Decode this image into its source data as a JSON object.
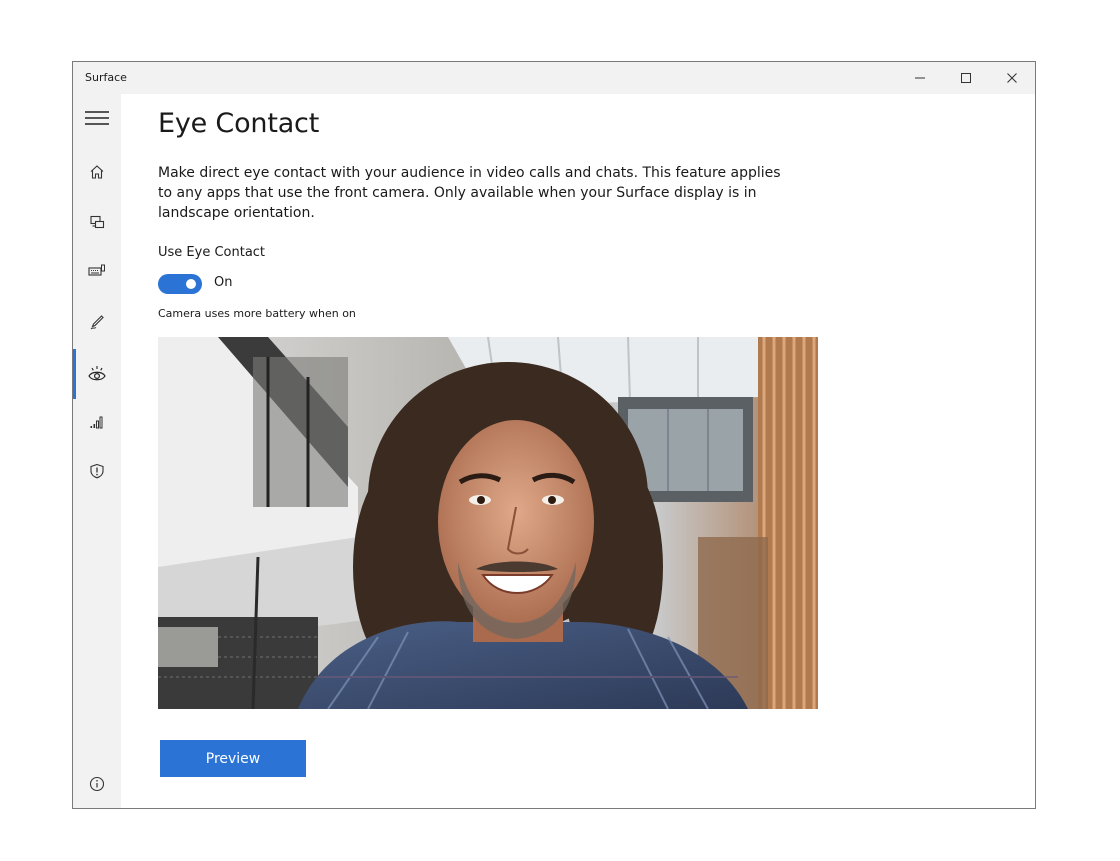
{
  "window": {
    "title": "Surface",
    "controls": [
      "minimize",
      "maximize",
      "close"
    ]
  },
  "sidebar": {
    "items": [
      {
        "icon": "hamburger-menu-icon",
        "active": false
      },
      {
        "icon": "home-icon",
        "active": false
      },
      {
        "icon": "devices-icon",
        "active": false
      },
      {
        "icon": "keyboard-icon",
        "active": false
      },
      {
        "icon": "pen-icon",
        "active": false
      },
      {
        "icon": "eye-contact-icon",
        "active": true
      },
      {
        "icon": "signal-bars-icon",
        "active": false
      },
      {
        "icon": "shield-icon",
        "active": false
      },
      {
        "icon": "info-icon",
        "active": false
      }
    ]
  },
  "page": {
    "title": "Eye Contact",
    "description": "Make direct eye contact with your audience in video calls and chats. This feature applies to any apps that use the front camera. Only available when your Surface display is in landscape orientation.",
    "toggle_label": "Use Eye Contact",
    "toggle_state": "On",
    "toggle_on": true,
    "note": "Camera uses more battery when on",
    "preview_button": "Preview"
  },
  "colors": {
    "accent": "#2b73d4",
    "sidebar_bg": "#f2f2f2",
    "titlebar_bg": "#f2f2f2"
  }
}
